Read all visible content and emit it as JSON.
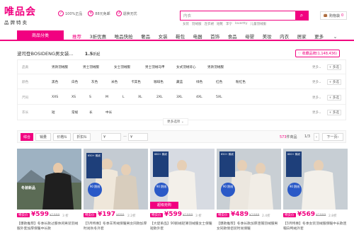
{
  "header": {
    "logo_title": "唯品会",
    "logo_sub": "品牌特卖",
    "promises": [
      "100%正品",
      "88元免邮",
      "退换无忧"
    ],
    "search": {
      "value": "内衣",
      "hot": [
        "女装",
        "羽绒服",
        "连衣裙",
        "短靴",
        "李宁",
        "lovertty",
        "儿童羽绒服"
      ]
    },
    "cart": "购物袋",
    "cart_count": "0"
  },
  "nav": {
    "category_btn": "商品分类",
    "items": [
      "推荐",
      "3折优惠",
      "唯品快抢",
      "奢品",
      "女装",
      "鞋包",
      "电器",
      "首饰",
      "食品",
      "母婴",
      "美妆",
      "内衣",
      "居家",
      "更多"
    ]
  },
  "breadcrumb": {
    "brand": "波司登BOSIDENG男女装...",
    "rating": "1.5",
    "rating_suffix": "折起",
    "fav": "收藏品牌(1,148,436)"
  },
  "filters": {
    "row1": {
      "label": "品类",
      "opts": [
        "男款羽绒服",
        "男士羽绒服",
        "女士羽绒服",
        "男士羽绒马甲",
        "女式羽绒背心",
        "男款羽绒服"
      ]
    },
    "row2": {
      "label": "颜色",
      "opts": [
        "黑色",
        "白色",
        "灰色",
        "米色",
        "卡其色",
        "咖啡色",
        "藏蓝",
        "绿色",
        "红色",
        "粉红色"
      ]
    },
    "row3": {
      "label": "尺码",
      "opts": [
        "XXS",
        "XS",
        "S",
        "M",
        "L",
        "XL",
        "2XL",
        "3XL",
        "4XL",
        "5XL"
      ]
    },
    "row4": {
      "label": "衣长",
      "opts": [
        "短",
        "常规",
        "长",
        "中长"
      ]
    },
    "more": "更多",
    "multi": "+ 多选",
    "more_options": "更多选项"
  },
  "sortbar": {
    "sort_default": "综合",
    "sales": "销量",
    "price": "价格",
    "discount": "折扣",
    "price_from": "¥",
    "price_to": "¥",
    "count": "573",
    "count_suffix": "件商品",
    "page": "1/3",
    "next": "下一页"
  },
  "products": [
    {
      "name": "product-1",
      "price": "599",
      "tag": "特卖价",
      "orig": "¥1999",
      "discount": "3 折",
      "desc": "【爆款推荐】冬季长款过膝休闲男装羽绒服外套加厚保暖中长款",
      "promo": "冬装新品",
      "bg1": "#8fa6b8",
      "bg2": "#5b6b55",
      "c_person": "#2a2a2a"
    },
    {
      "name": "product-2",
      "price": "197",
      "tag": "特卖价",
      "orig": "¥899",
      "discount": "2.2折",
      "desc": "【3月特惠】冬季羊羔绒保暖男女同款加厚时尚秋冬外套",
      "promo": "",
      "bg1": "#bcc3c9",
      "bg2": "#8d9aa8",
      "c_person": "#d8cdbd"
    },
    {
      "name": "product-3",
      "price": "599",
      "tag": "特卖价",
      "orig": "¥1999",
      "discount": "3 折",
      "desc": "【大促单品】90鹅绒轻薄羽绒服女士保暖短款外套",
      "promo": "超级抢购",
      "bg1": "#d7dbe2",
      "bg2": "#a7b2bf",
      "c_person": "#efece7"
    },
    {
      "name": "product-4",
      "price": "489",
      "tag": "特卖价",
      "orig": "¥1999",
      "discount": "2.4折",
      "desc": "【爆款推荐】冬季长款加厚连帽羽绒服男女同款情侣装时尚保暖",
      "promo": "",
      "bg1": "#c9cfd4",
      "bg2": "#a0a8b0",
      "c_person": "#f1ede6"
    },
    {
      "name": "product-5",
      "price": "569",
      "tag": "特卖价",
      "orig": "¥1999",
      "discount": "2.8折",
      "desc": "【3月特惠】冬季女装羽绒服保暖中长款连帽白鸭绒外套",
      "promo": "",
      "bg1": "#c7ced4",
      "bg2": "#8e9aa4",
      "c_person": "#f3f0ea"
    }
  ],
  "card_badge": "90\n鹅绒",
  "colors": {
    "brand": "#f10180"
  }
}
